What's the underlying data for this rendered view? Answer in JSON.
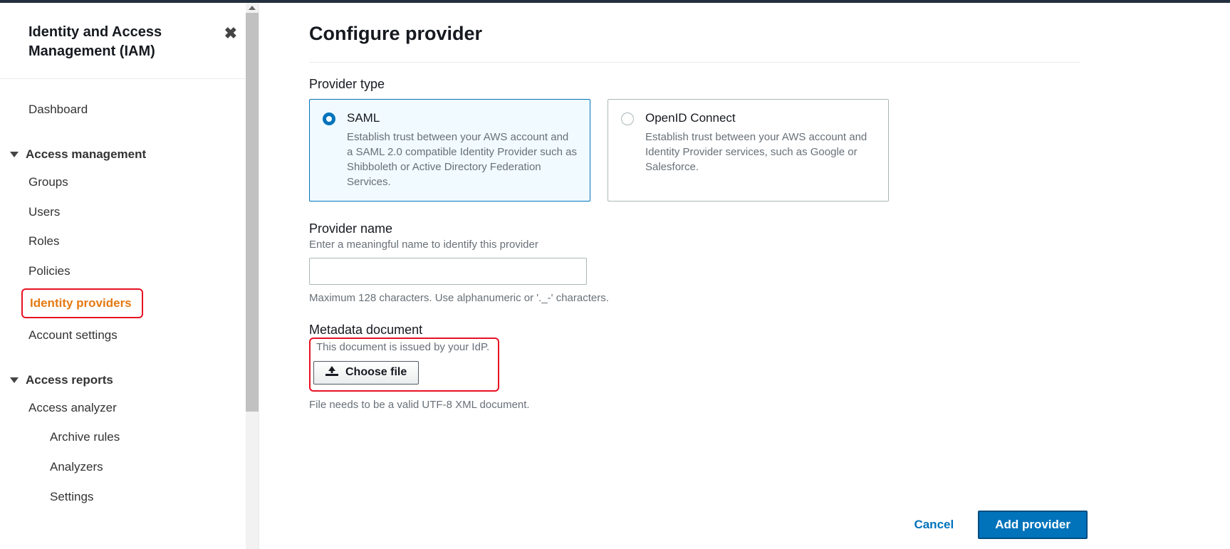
{
  "sidebar": {
    "title": "Identity and Access Management (IAM)",
    "items": {
      "dashboard": "Dashboard",
      "access_mgmt_group": "Access management",
      "groups": "Groups",
      "users": "Users",
      "roles": "Roles",
      "policies": "Policies",
      "identity_providers": "Identity providers",
      "account_settings": "Account settings",
      "access_reports_group": "Access reports",
      "access_analyzer": "Access analyzer",
      "archive_rules": "Archive rules",
      "analyzers": "Analyzers",
      "settings": "Settings"
    }
  },
  "page": {
    "title": "Configure provider",
    "provider_type": {
      "label": "Provider type",
      "options": {
        "saml": {
          "title": "SAML",
          "desc": "Establish trust between your AWS account and a SAML 2.0 compatible Identity Provider such as Shibboleth or Active Directory Federation Services."
        },
        "oidc": {
          "title": "OpenID Connect",
          "desc": "Establish trust between your AWS account and Identity Provider services, such as Google or Salesforce."
        }
      }
    },
    "provider_name": {
      "label": "Provider name",
      "hint": "Enter a meaningful name to identify this provider",
      "value": "",
      "constraint": "Maximum 128 characters. Use alphanumeric or '._-' characters."
    },
    "metadata": {
      "label": "Metadata document",
      "hint": "This document is issued by your IdP.",
      "button": "Choose file",
      "constraint": "File needs to be a valid UTF-8 XML document."
    },
    "actions": {
      "cancel": "Cancel",
      "add": "Add provider"
    }
  }
}
